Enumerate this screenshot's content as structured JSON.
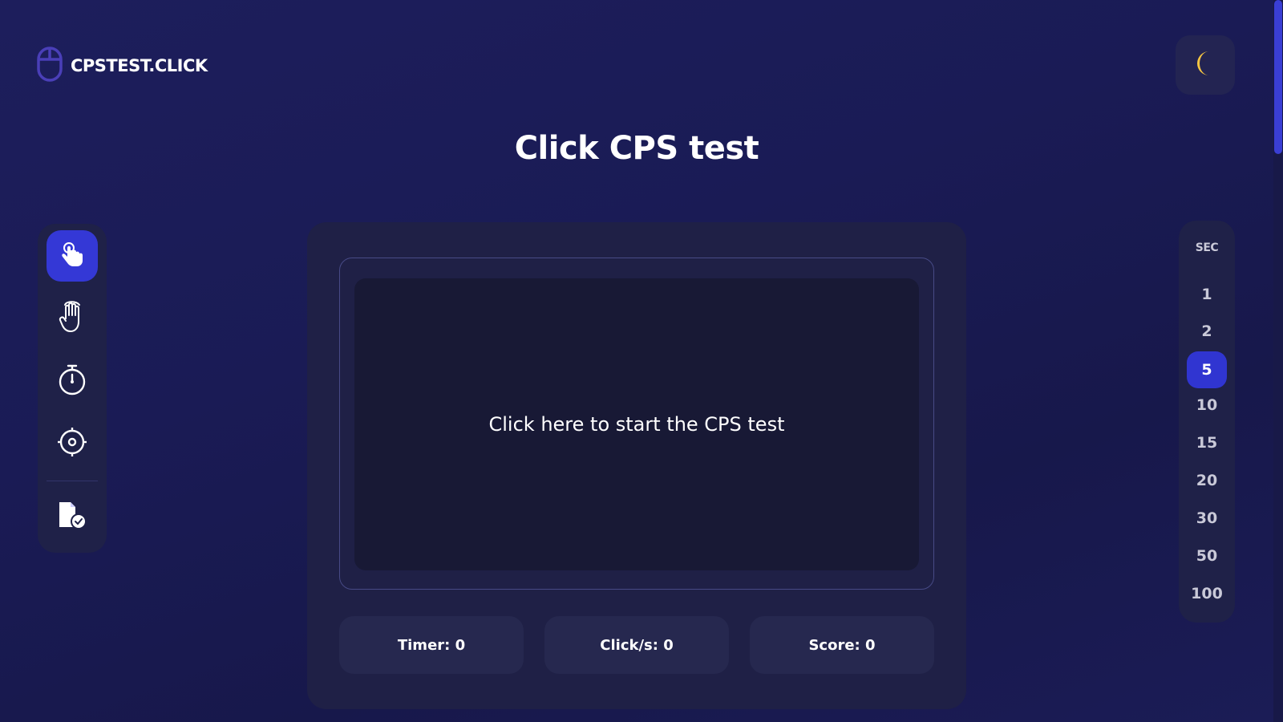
{
  "header": {
    "logo_text": "CPSTEST.CLICK",
    "logo_icon": "mouse-icon",
    "theme_icon": "moon-icon"
  },
  "page_title": "Click CPS test",
  "mode_bar": {
    "items": [
      {
        "icon": "tap-hand-icon",
        "active": true
      },
      {
        "icon": "multi-finger-hand-icon",
        "active": false
      },
      {
        "icon": "stopwatch-icon",
        "active": false
      },
      {
        "icon": "target-icon",
        "active": false
      },
      {
        "icon": "document-check-icon",
        "active": false
      }
    ]
  },
  "click_area": {
    "prompt": "Click here to start the CPS test"
  },
  "stats": {
    "timer": "Timer: 0",
    "clicks_per_second": "Click/s: 0",
    "score": "Score: 0"
  },
  "seconds": {
    "label": "SEC",
    "options": [
      "1",
      "2",
      "5",
      "10",
      "15",
      "20",
      "30",
      "50",
      "100"
    ],
    "selected": "5"
  },
  "colors": {
    "accent": "#3438d6",
    "background": "#1b1c56",
    "panel": "#1f2148",
    "moon": "#f5c542"
  }
}
